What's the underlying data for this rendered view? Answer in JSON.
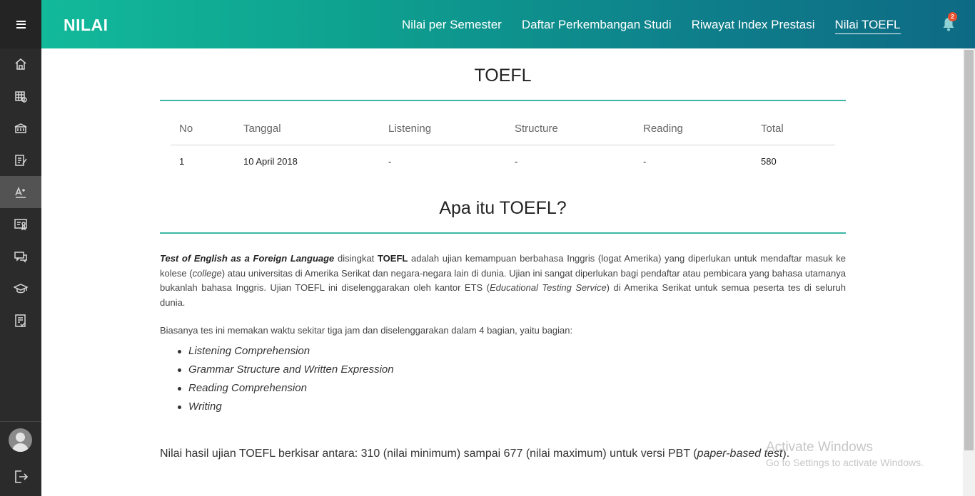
{
  "header": {
    "brand": "NILAI",
    "nav": [
      {
        "label": "Nilai per Semester"
      },
      {
        "label": "Daftar Perkembangan Studi"
      },
      {
        "label": "Riwayat Index Prestasi"
      },
      {
        "label": "Nilai TOEFL"
      }
    ],
    "active_nav": "Nilai TOEFL",
    "notification_count": "2"
  },
  "sidebar": {
    "items": [
      "home-icon",
      "schedule-grid-icon",
      "building-icon",
      "document-edit-icon",
      "text-size-icon",
      "certificate-icon",
      "chat-icon",
      "graduation-cap-icon",
      "checklist-icon"
    ],
    "active_item": "text-size-icon",
    "bottom": [
      "avatar",
      "logout-icon"
    ]
  },
  "content": {
    "title": "TOEFL",
    "table": {
      "headers": [
        "No",
        "Tanggal",
        "Listening",
        "Structure",
        "Reading",
        "Total"
      ],
      "rows": [
        [
          "1",
          "10 April 2018",
          "-",
          "-",
          "-",
          "580"
        ]
      ]
    },
    "about_title": "Apa itu TOEFL?",
    "para1": {
      "italic_bold_term": "Test of English as a Foreign Language",
      "text1": " disingkat ",
      "abbr": "TOEFL",
      "text2": " adalah ujian kemampuan berbahasa Inggris (logat Amerika) yang diperlukan untuk mendaftar masuk ke kolese (",
      "college": "college",
      "text3": ") atau universitas di Amerika Serikat dan negara-negara lain di dunia. Ujian ini sangat diperlukan bagi pendaftar atau pembicara yang bahasa utamanya bukanlah bahasa Inggris. Ujian TOEFL ini diselenggarakan oleh kantor ETS (",
      "ets": "Educational Testing Service",
      "text4": ") di Amerika Serikat untuk semua peserta tes di seluruh dunia."
    },
    "para2": "Biasanya tes ini memakan waktu sekitar tiga jam dan diselenggarakan dalam 4 bagian, yaitu bagian:",
    "sections": [
      "Listening Comprehension",
      "Grammar Structure and Written Expression",
      "Reading Comprehension",
      "Writing"
    ],
    "range": {
      "text": "Nilai hasil ujian TOEFL berkisar antara: 310 (nilai minimum) sampai 677 (nilai maximum) untuk versi PBT (",
      "italic": "paper-based test",
      "end": ")."
    }
  },
  "watermark": {
    "line1": "Activate Windows",
    "line2": "Go to Settings to activate Windows."
  }
}
